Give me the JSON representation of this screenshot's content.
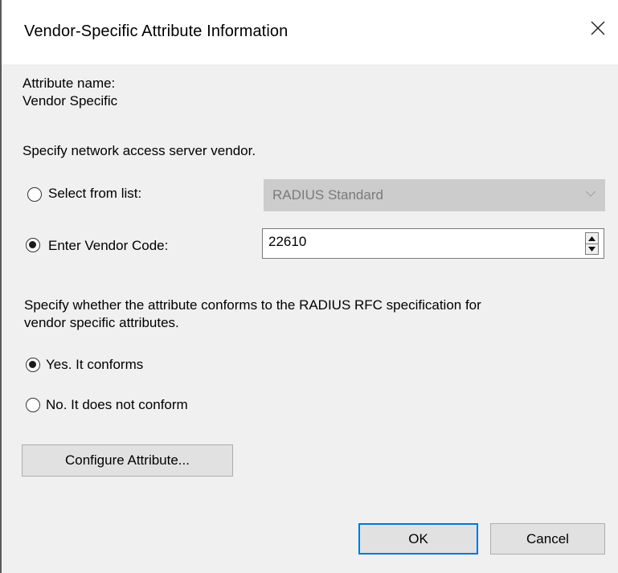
{
  "dialog": {
    "title": "Vendor-Specific Attribute Information"
  },
  "attribute": {
    "name_label": "Attribute name:",
    "name_value": "Vendor Specific"
  },
  "vendor": {
    "instruction": "Specify network access server vendor.",
    "select_from_list_label": "Select from list:",
    "select_from_list_checked": false,
    "list_selected_value": "RADIUS Standard",
    "list_disabled": true,
    "enter_code_label": "Enter Vendor Code:",
    "enter_code_checked": true,
    "vendor_code_value": "22610"
  },
  "conformance": {
    "instruction_line1": "Specify whether the attribute conforms to the RADIUS RFC specification for",
    "instruction_line2": "vendor specific attributes.",
    "yes_label": "Yes. It conforms",
    "yes_checked": true,
    "no_label": "No. It does not conform",
    "no_checked": false
  },
  "buttons": {
    "configure_label": "Configure Attribute...",
    "ok_label": "OK",
    "cancel_label": "Cancel"
  },
  "icons": {
    "close": "close-icon",
    "dropdown": "chevron-down-icon",
    "spin_up": "spin-up-icon",
    "spin_down": "spin-down-icon"
  },
  "colors": {
    "dialog_bg": "#f0f0f0",
    "titlebar_bg": "#ffffff",
    "default_button_border": "#0078d7",
    "disabled_field_bg": "#cccccc"
  }
}
